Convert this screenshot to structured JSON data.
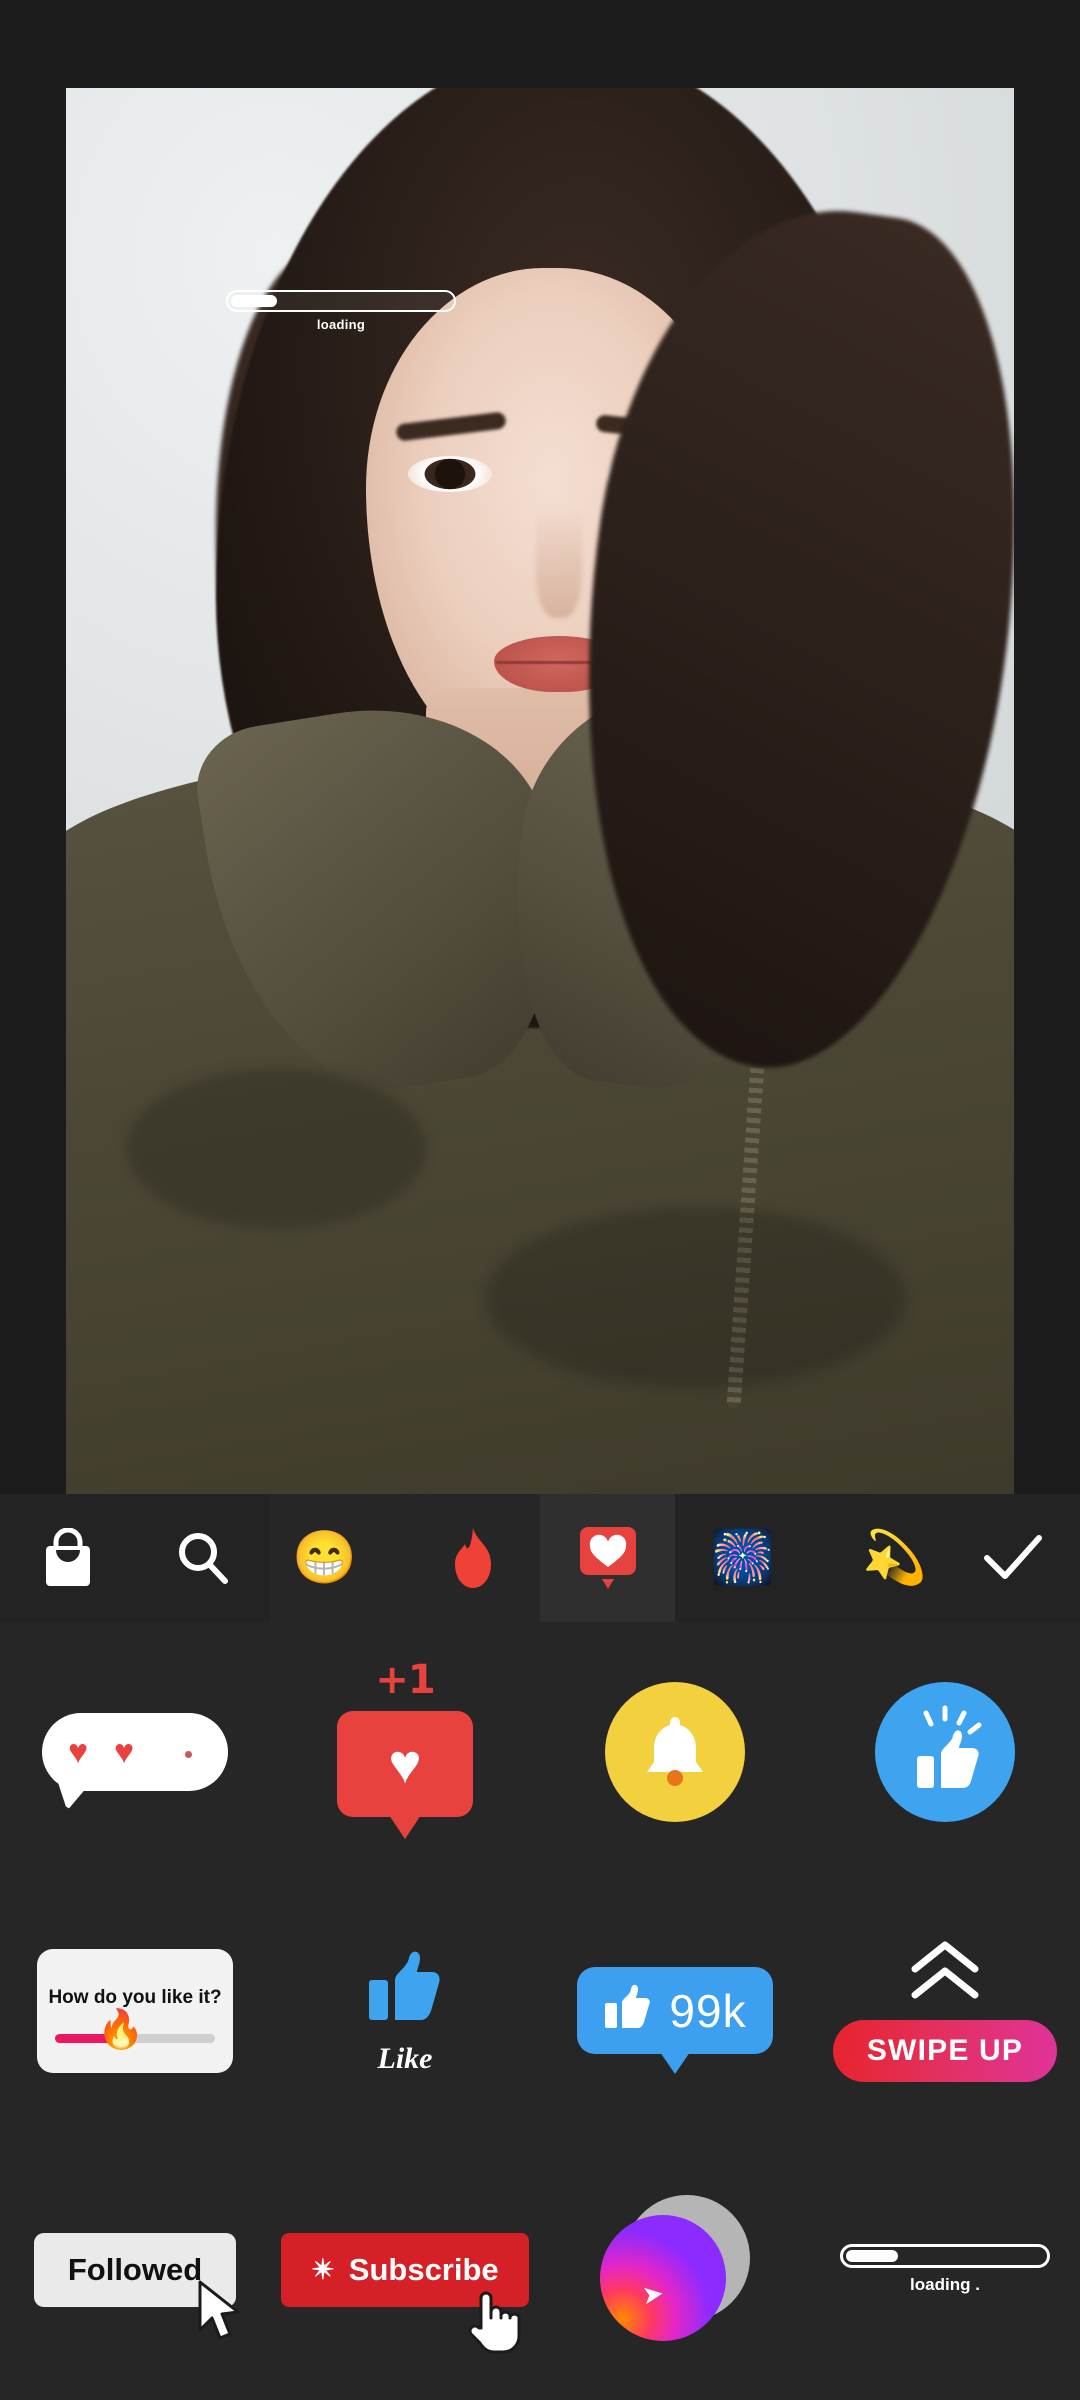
{
  "app": {
    "background_color": "#1c1c1c",
    "panel_color": "#262626"
  },
  "canvas": {
    "name": "photo-canvas",
    "overlay_loading": {
      "icon": "loading-bar-icon",
      "label": "loading",
      "progress_percent": 18
    }
  },
  "category_bar": {
    "tabs": [
      {
        "id": "shop",
        "icon": "shopping-bag-icon",
        "label": "Shop",
        "selected": false
      },
      {
        "id": "search",
        "icon": "search-icon",
        "label": "Search",
        "selected": false
      },
      {
        "id": "emoji",
        "icon": "grinning-emoji-icon",
        "label": "Emoji",
        "selected": false
      },
      {
        "id": "flame",
        "icon": "flame-icon",
        "label": "Trending",
        "selected": false
      },
      {
        "id": "social",
        "icon": "heart-notification-icon",
        "label": "Social",
        "selected": true
      },
      {
        "id": "firework",
        "icon": "firework-icon",
        "label": "Effects",
        "selected": false
      },
      {
        "id": "sparkle",
        "icon": "purple-sparkle-icon",
        "label": "Sparkle",
        "selected": false
      },
      {
        "id": "confirm",
        "icon": "checkmark-icon",
        "label": "Done",
        "selected": false
      }
    ]
  },
  "stickers": {
    "rows": [
      [
        {
          "id": "comment-hearts",
          "name": "comment-bubble-hearts-sticker",
          "label": ""
        },
        {
          "id": "heart-plus-one",
          "name": "heart-notification-sticker",
          "label": "+1"
        },
        {
          "id": "bell",
          "name": "bell-notification-sticker",
          "label": ""
        },
        {
          "id": "thumbs-up-circle",
          "name": "thumbs-up-circle-sticker",
          "label": ""
        }
      ],
      [
        {
          "id": "poll-card",
          "name": "poll-slider-sticker",
          "label": "How do you like it?",
          "slider_percent": 42,
          "emoji": "fire-emoji"
        },
        {
          "id": "like",
          "name": "like-thumb-sticker",
          "label": "Like"
        },
        {
          "id": "like-count",
          "name": "like-count-sticker",
          "label": "99k"
        },
        {
          "id": "swipe-up",
          "name": "swipe-up-sticker",
          "label": "SWIPE UP"
        }
      ],
      [
        {
          "id": "followed",
          "name": "followed-button-sticker",
          "label": "Followed",
          "cursor": "arrow-cursor-icon"
        },
        {
          "id": "subscribe",
          "name": "subscribe-button-sticker",
          "label": "Subscribe",
          "star": "✴",
          "cursor": "hand-cursor-icon"
        },
        {
          "id": "share-orb",
          "name": "gradient-share-orb-sticker",
          "label": ""
        },
        {
          "id": "loading",
          "name": "loading-bar-sticker",
          "label": "loading .",
          "progress_percent": 24
        }
      ]
    ]
  },
  "colors": {
    "accent_red": "#e8423f",
    "subscribe_red": "#d42026",
    "like_blue": "#3c9ff0",
    "bell_yellow": "#f3d03e",
    "poll_pink": "#ec1763",
    "swipe_gradient_from": "#e8232b",
    "swipe_gradient_to": "#e0339b"
  }
}
